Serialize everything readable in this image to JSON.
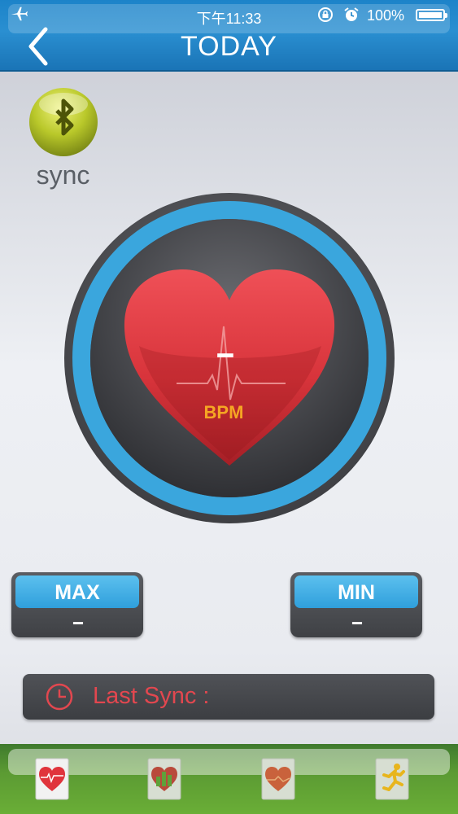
{
  "status_bar": {
    "time": "下午11:33",
    "battery": "100%",
    "icons": [
      "airplane-icon",
      "rotation-lock-icon",
      "alarm-icon",
      "battery-icon"
    ]
  },
  "header": {
    "title": "TODAY",
    "back_icon": "chevron-left-icon"
  },
  "sync": {
    "label": "sync",
    "icon": "bluetooth-icon"
  },
  "heart_rate": {
    "value": "--",
    "unit": "BPM"
  },
  "stats": {
    "max_label": "MAX",
    "max_value": "--",
    "min_label": "MIN",
    "min_value": "--"
  },
  "last_sync": {
    "label": "Last Sync :"
  },
  "tabs": [
    {
      "name": "heart-rate-tab",
      "icon": "heart-pulse-icon"
    },
    {
      "name": "chart-tab",
      "icon": "bar-chart-icon"
    },
    {
      "name": "history-tab",
      "icon": "heart-icon"
    },
    {
      "name": "activity-tab",
      "icon": "runner-icon"
    }
  ],
  "colors": {
    "header_blue": "#1c83c9",
    "ring_blue": "#3aa6dd",
    "heart_red": "#d8343b",
    "bpm_orange": "#f5a623",
    "last_sync_red": "#e2474f",
    "tab_green": "#5b9a33",
    "sync_button": "#b9c82a"
  }
}
